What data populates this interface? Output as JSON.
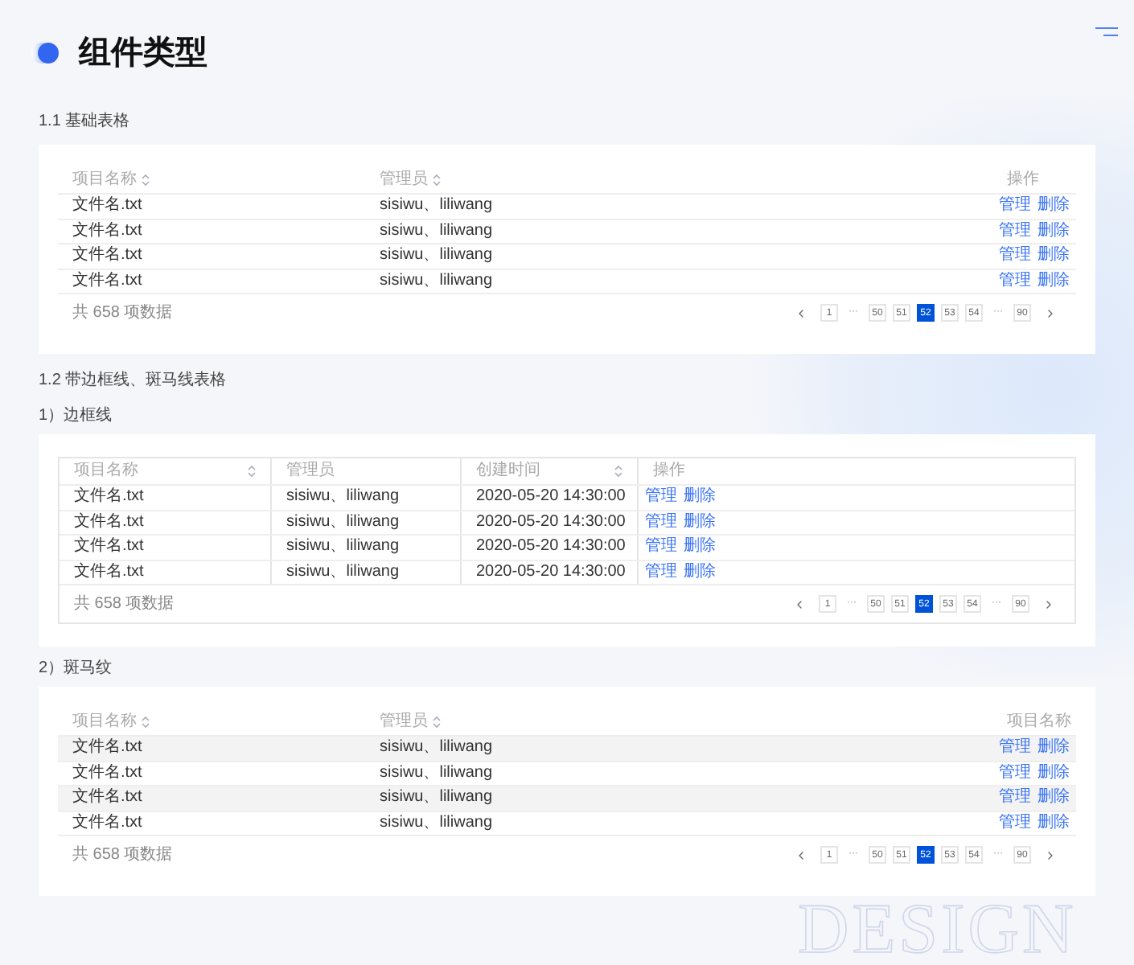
{
  "page": {
    "title": "组件类型",
    "watermark": "DESIGN"
  },
  "blocks": [
    {
      "kind": "heading",
      "text": "1.1 基础表格"
    },
    {
      "kind": "table",
      "bordered": false,
      "columns": [
        {
          "label": "项目名称",
          "sortable": true
        },
        {
          "label": "管理员",
          "sortable": true
        },
        {
          "label": "操作",
          "sortable": false
        }
      ],
      "rows": [
        {
          "shaded": false,
          "cells": [
            "文件名.txt",
            "sisiwu、liliwang"
          ],
          "actions": [
            "管理",
            "删除"
          ]
        },
        {
          "shaded": false,
          "cells": [
            "文件名.txt",
            "sisiwu、liliwang"
          ],
          "actions": [
            "管理",
            "删除"
          ]
        },
        {
          "shaded": false,
          "cells": [
            "文件名.txt",
            "sisiwu、liliwang"
          ],
          "actions": [
            "管理",
            "删除"
          ]
        },
        {
          "shaded": false,
          "cells": [
            "文件名.txt",
            "sisiwu、liliwang"
          ],
          "actions": [
            "管理",
            "删除"
          ]
        }
      ],
      "total": "共 658 项数据",
      "pagination": [
        {
          "kind": "prev"
        },
        {
          "kind": "page",
          "label": "1",
          "selected": false
        },
        {
          "kind": "ellipsis",
          "label": "···"
        },
        {
          "kind": "page",
          "label": "50",
          "selected": false
        },
        {
          "kind": "page",
          "label": "51",
          "selected": false
        },
        {
          "kind": "page",
          "label": "52",
          "selected": true
        },
        {
          "kind": "page",
          "label": "53",
          "selected": false
        },
        {
          "kind": "page",
          "label": "54",
          "selected": false
        },
        {
          "kind": "ellipsis",
          "label": "···"
        },
        {
          "kind": "page",
          "label": "90",
          "selected": false
        },
        {
          "kind": "next"
        }
      ]
    },
    {
      "kind": "heading",
      "text": "1.2 带边框线、斑马线表格"
    },
    {
      "kind": "subheading",
      "text": "1）边框线"
    },
    {
      "kind": "table",
      "bordered": true,
      "columns": [
        {
          "label": "项目名称",
          "sortable": true
        },
        {
          "label": "管理员",
          "sortable": false
        },
        {
          "label": "创建时间",
          "sortable": true
        },
        {
          "label": "操作",
          "sortable": false
        }
      ],
      "rows": [
        {
          "shaded": false,
          "cells": [
            "文件名.txt",
            "sisiwu、liliwang",
            "2020-05-20 14:30:00"
          ],
          "actions": [
            "管理",
            "删除"
          ]
        },
        {
          "shaded": false,
          "cells": [
            "文件名.txt",
            "sisiwu、liliwang",
            "2020-05-20 14:30:00"
          ],
          "actions": [
            "管理",
            "删除"
          ]
        },
        {
          "shaded": false,
          "cells": [
            "文件名.txt",
            "sisiwu、liliwang",
            "2020-05-20 14:30:00"
          ],
          "actions": [
            "管理",
            "删除"
          ]
        },
        {
          "shaded": false,
          "cells": [
            "文件名.txt",
            "sisiwu、liliwang",
            "2020-05-20 14:30:00"
          ],
          "actions": [
            "管理",
            "删除"
          ]
        }
      ],
      "total": "共 658 项数据",
      "pagination": [
        {
          "kind": "prev"
        },
        {
          "kind": "page",
          "label": "1",
          "selected": false
        },
        {
          "kind": "ellipsis",
          "label": "···"
        },
        {
          "kind": "page",
          "label": "50",
          "selected": false
        },
        {
          "kind": "page",
          "label": "51",
          "selected": false
        },
        {
          "kind": "page",
          "label": "52",
          "selected": true
        },
        {
          "kind": "page",
          "label": "53",
          "selected": false
        },
        {
          "kind": "page",
          "label": "54",
          "selected": false
        },
        {
          "kind": "ellipsis",
          "label": "···"
        },
        {
          "kind": "page",
          "label": "90",
          "selected": false
        },
        {
          "kind": "next"
        }
      ]
    },
    {
      "kind": "subheading",
      "text": "2）斑马纹"
    },
    {
      "kind": "table",
      "bordered": false,
      "columns": [
        {
          "label": "项目名称",
          "sortable": true
        },
        {
          "label": "管理员",
          "sortable": true
        },
        {
          "label": "项目名称",
          "sortable": false
        }
      ],
      "rows": [
        {
          "shaded": true,
          "cells": [
            "文件名.txt",
            "sisiwu、liliwang"
          ],
          "actions": [
            "管理",
            "删除"
          ]
        },
        {
          "shaded": false,
          "cells": [
            "文件名.txt",
            "sisiwu、liliwang"
          ],
          "actions": [
            "管理",
            "删除"
          ]
        },
        {
          "shaded": true,
          "cells": [
            "文件名.txt",
            "sisiwu、liliwang"
          ],
          "actions": [
            "管理",
            "删除"
          ]
        },
        {
          "shaded": false,
          "cells": [
            "文件名.txt",
            "sisiwu、liliwang"
          ],
          "actions": [
            "管理",
            "删除"
          ]
        }
      ],
      "total": "共 658 项数据",
      "pagination": [
        {
          "kind": "prev"
        },
        {
          "kind": "page",
          "label": "1",
          "selected": false
        },
        {
          "kind": "ellipsis",
          "label": "···"
        },
        {
          "kind": "page",
          "label": "50",
          "selected": false
        },
        {
          "kind": "page",
          "label": "51",
          "selected": false
        },
        {
          "kind": "page",
          "label": "52",
          "selected": true
        },
        {
          "kind": "page",
          "label": "53",
          "selected": false
        },
        {
          "kind": "page",
          "label": "54",
          "selected": false
        },
        {
          "kind": "ellipsis",
          "label": "···"
        },
        {
          "kind": "page",
          "label": "90",
          "selected": false
        },
        {
          "kind": "next"
        }
      ]
    }
  ]
}
